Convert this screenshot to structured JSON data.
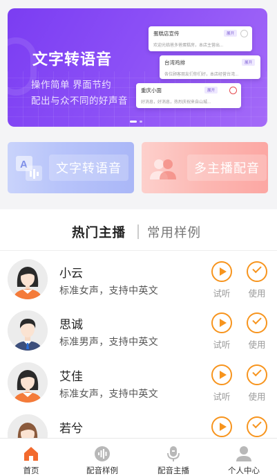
{
  "banner": {
    "title": "文字转语音",
    "subtitle_line1": "操作简单 界面节约",
    "subtitle_line2": "配出与众不同的好声音",
    "cards": [
      {
        "title": "蛋糕店宣传",
        "tag": "展开",
        "desc": "欢迎光临爸多爸蛋糕房，本店主营出..."
      },
      {
        "title": "台湾鸡排",
        "tag": "展开",
        "desc": "各位顾客朋友们你们好，本店经营台湾..."
      },
      {
        "title": "重庆小面",
        "tag": "展开",
        "desc": "好消息，好消息，热烈庆祝来自山城..."
      }
    ]
  },
  "features": [
    {
      "label": "文字转语音",
      "icon": "translate-icon"
    },
    {
      "label": "多主播配音",
      "icon": "multi-user-icon"
    }
  ],
  "tabs": [
    {
      "label": "热门主播",
      "active": true
    },
    {
      "label": "常用样例",
      "active": false
    }
  ],
  "anchors": [
    {
      "name": "小云",
      "desc": "标准女声，支持中英文",
      "gender": "female",
      "listen_label": "试听",
      "use_label": "使用"
    },
    {
      "name": "思诚",
      "desc": "标准男声，支持中英文",
      "gender": "male",
      "listen_label": "试听",
      "use_label": "使用"
    },
    {
      "name": "艾佳",
      "desc": "标准女声，支持中英文",
      "gender": "female",
      "listen_label": "试听",
      "use_label": "使用"
    },
    {
      "name": "若兮",
      "desc": "",
      "gender": "female2",
      "listen_label": "",
      "use_label": ""
    }
  ],
  "nav": [
    {
      "label": "首页",
      "icon": "home-icon",
      "active": true
    },
    {
      "label": "配音样例",
      "icon": "waveform-icon",
      "active": false
    },
    {
      "label": "配音主播",
      "icon": "microphone-icon",
      "active": false
    },
    {
      "label": "个人中心",
      "icon": "person-icon",
      "active": false
    }
  ],
  "colors": {
    "accent": "#f7941d",
    "banner": "#7b3df2",
    "nav_active": "#f26a2e"
  }
}
